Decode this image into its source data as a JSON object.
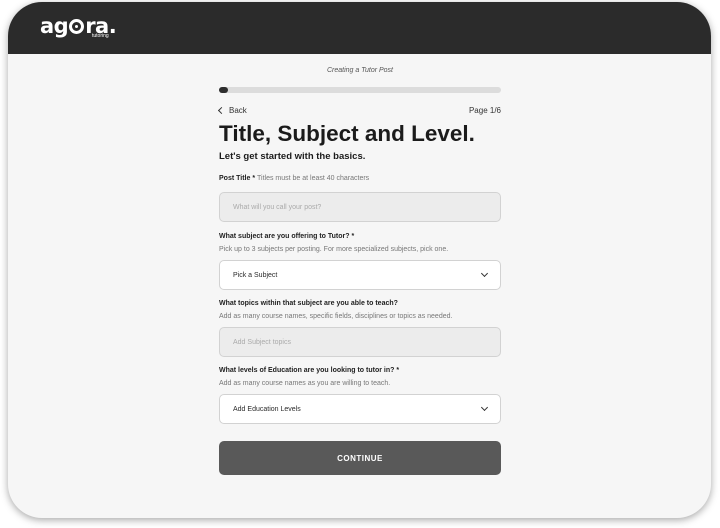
{
  "brand": {
    "logo_text_a": "ag",
    "logo_text_b": "ra.",
    "logo_sub": "tutoring"
  },
  "header": {
    "step_caption": "Creating a Tutor Post",
    "progress_fraction": 0.0333,
    "back_label": "Back",
    "page_label": "Page 1/6",
    "title": "Title, Subject and Level.",
    "subtitle": "Let's get started with the basics."
  },
  "form": {
    "post_title": {
      "label": "Post Title *",
      "hint": "Titles must be at least 40 characters",
      "placeholder": "What will you call your post?"
    },
    "subject": {
      "label": "What subject are you offering to Tutor? *",
      "help": "Pick up to 3 subjects per posting. For more specialized subjects, pick one.",
      "selected": "Pick a Subject"
    },
    "topics": {
      "label": "What topics within that subject are you able to teach?",
      "help": "Add as many course names, specific fields, disciplines or topics as needed.",
      "placeholder": "Add Subject topics"
    },
    "levels": {
      "label": "What levels of Education are you looking to tutor in? *",
      "help": "Add as many course names as you are willing to teach.",
      "selected": "Add Education Levels"
    },
    "continue_label": "CONTINUE"
  },
  "colors": {
    "topbar": "#2b2b2b",
    "button": "#595959",
    "progress": "#2e2e2e"
  }
}
